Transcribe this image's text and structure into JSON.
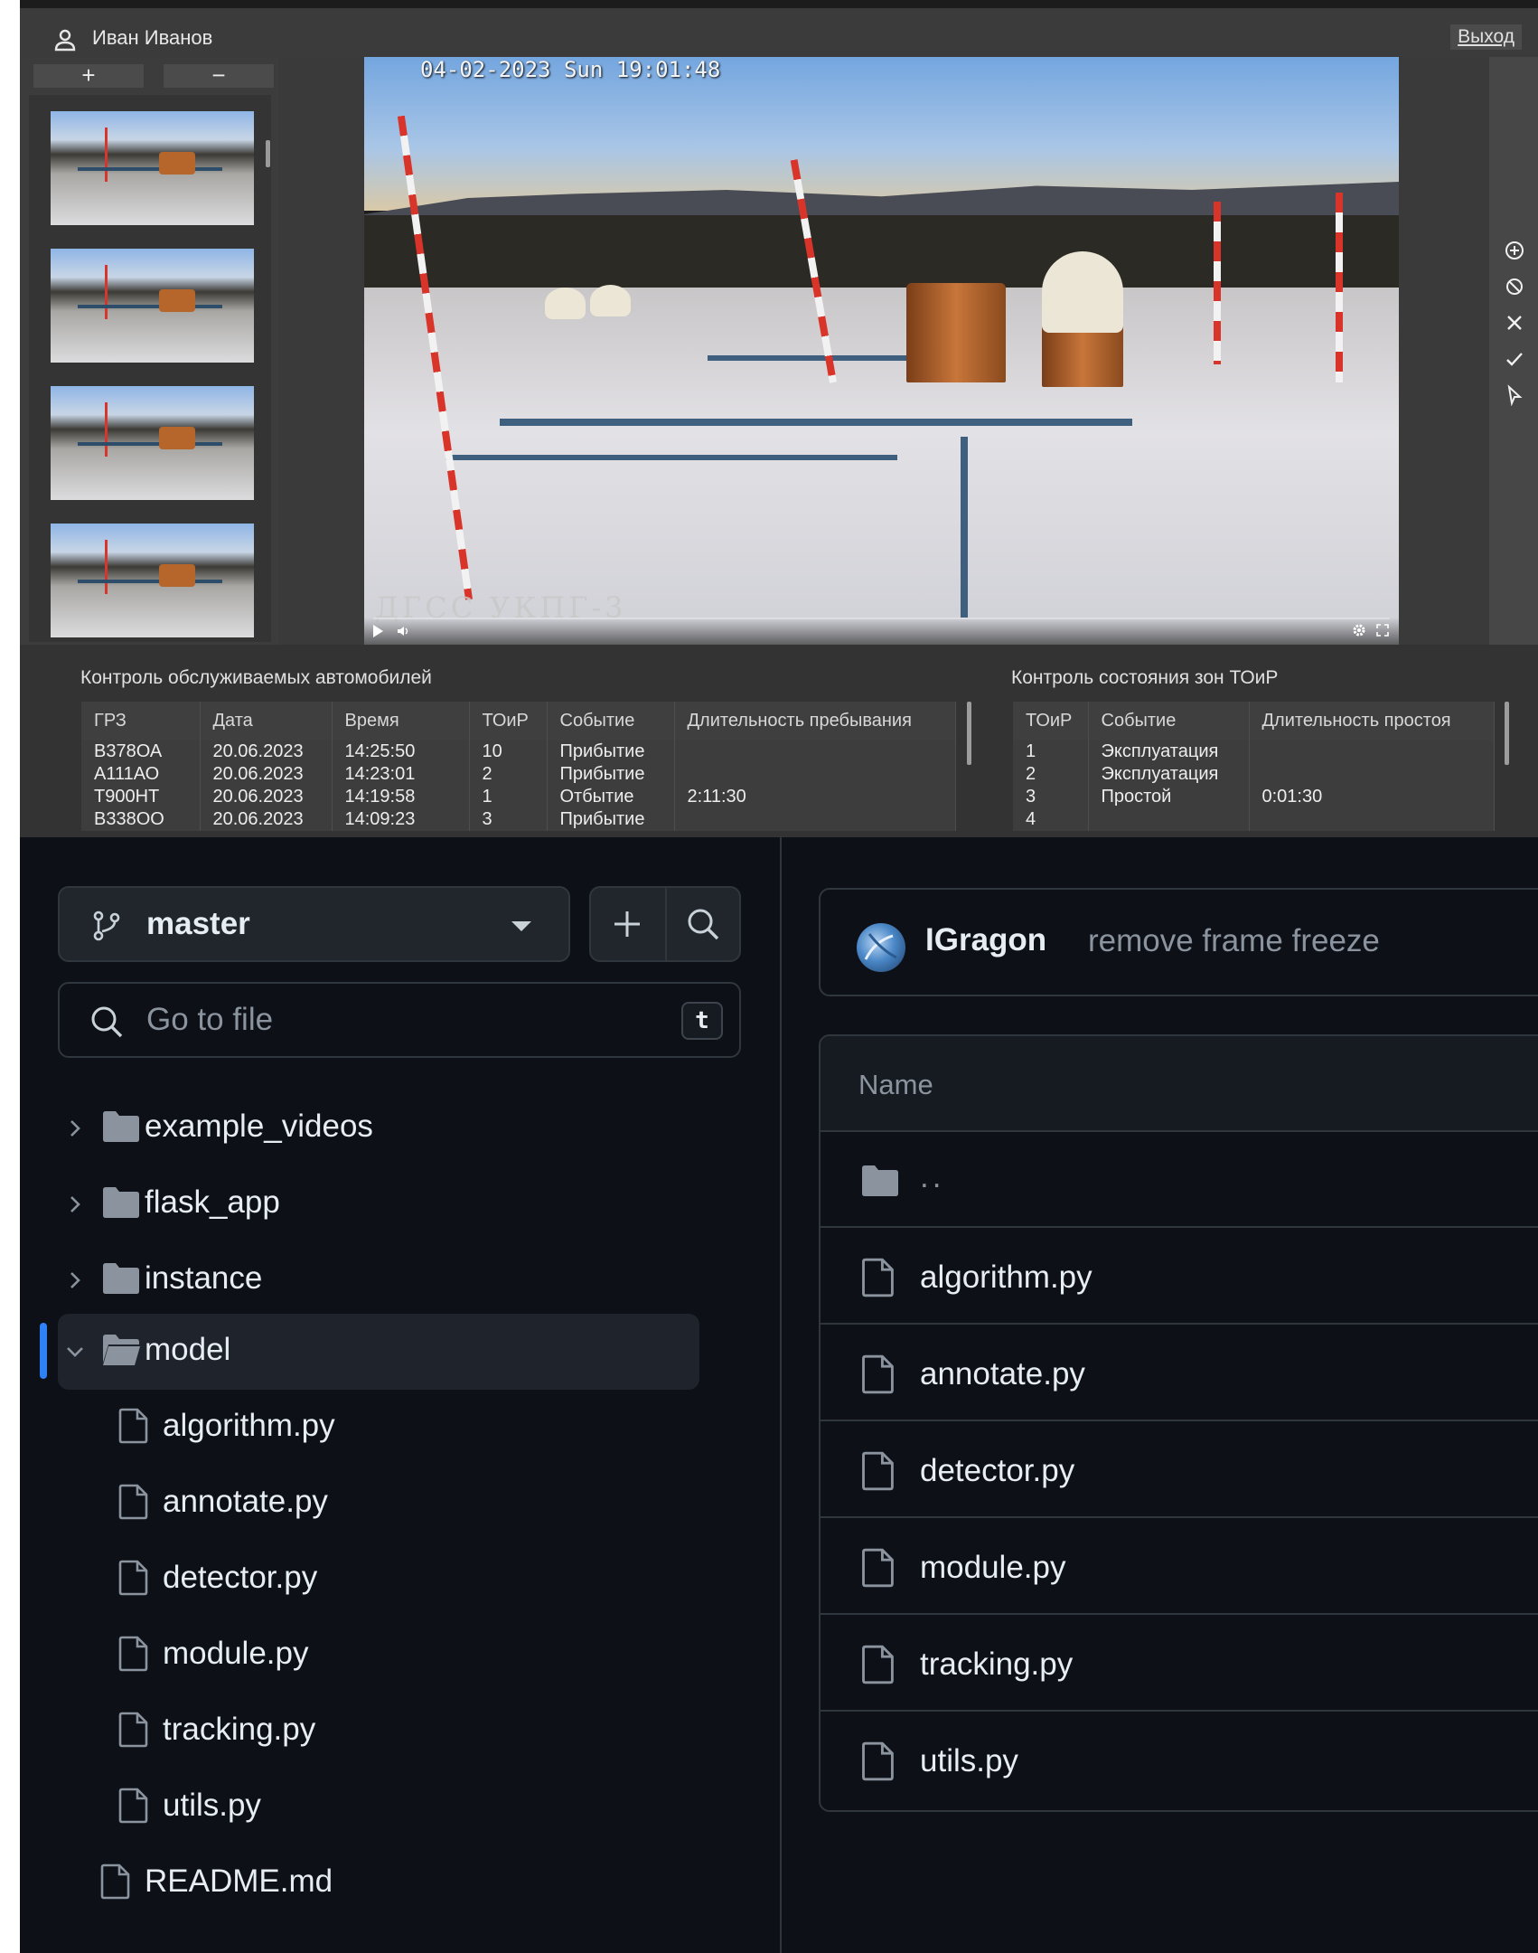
{
  "cctv": {
    "user_name": "Иван Иванов",
    "logout_label": "Выход",
    "add_camera_label": "+",
    "remove_camera_label": "−",
    "video": {
      "timestamp": "04-02-2023 Sun 19:01:48",
      "site_label": "ДГСС УКПГ-3"
    },
    "tools": [
      "zoom-in-icon",
      "block-icon",
      "close-icon",
      "check-icon",
      "cursor-icon"
    ],
    "cars_panel": {
      "title": "Контроль обслуживаемых автомобилей",
      "columns": [
        "ГРЗ",
        "Дата",
        "Время",
        "ТОиР",
        "Событие",
        "Длительность пребывания"
      ],
      "rows": [
        [
          "В378ОА",
          "20.06.2023",
          "14:25:50",
          "10",
          "Прибытие",
          ""
        ],
        [
          "А111АО",
          "20.06.2023",
          "14:23:01",
          "2",
          "Прибытие",
          ""
        ],
        [
          "Т900НТ",
          "20.06.2023",
          "14:19:58",
          "1",
          "Отбытие",
          "2:11:30"
        ],
        [
          "В338ОО",
          "20.06.2023",
          "14:09:23",
          "3",
          "Прибытие",
          ""
        ]
      ]
    },
    "zones_panel": {
      "title": "Контроль состояния зон ТОиР",
      "columns": [
        "ТОиР",
        "Событие",
        "Длительность простоя"
      ],
      "rows": [
        [
          "1",
          "Эксплуатация",
          ""
        ],
        [
          "2",
          "Эксплуатация",
          ""
        ],
        [
          "3",
          "Простой",
          "0:01:30"
        ],
        [
          "4",
          "",
          ""
        ]
      ]
    },
    "colors": {
      "event_green": "#56d23b",
      "event_red": "#e04a3c"
    }
  },
  "github": {
    "branch": "master",
    "go_to_file_placeholder": "Go to file",
    "shortcut_key": "t",
    "tree": [
      {
        "label": "example_videos",
        "type": "folder",
        "expanded": false
      },
      {
        "label": "flask_app",
        "type": "folder",
        "expanded": false
      },
      {
        "label": "instance",
        "type": "folder",
        "expanded": false
      },
      {
        "label": "model",
        "type": "folder",
        "expanded": true
      },
      {
        "label": "algorithm.py",
        "type": "file"
      },
      {
        "label": "annotate.py",
        "type": "file"
      },
      {
        "label": "detector.py",
        "type": "file"
      },
      {
        "label": "module.py",
        "type": "file"
      },
      {
        "label": "tracking.py",
        "type": "file"
      },
      {
        "label": "utils.py",
        "type": "file"
      },
      {
        "label": "README.md",
        "type": "file"
      }
    ],
    "commit": {
      "author": "IGragon",
      "message": "remove frame freeze"
    },
    "files_header": "Name",
    "parent_dir_label": "..",
    "files": [
      "algorithm.py",
      "annotate.py",
      "detector.py",
      "module.py",
      "tracking.py",
      "utils.py"
    ],
    "colors": {
      "background": "#0d1117",
      "border": "#30363d",
      "accent": "#2f81f7",
      "text": "#e6edf3",
      "muted": "#8b949e"
    }
  }
}
